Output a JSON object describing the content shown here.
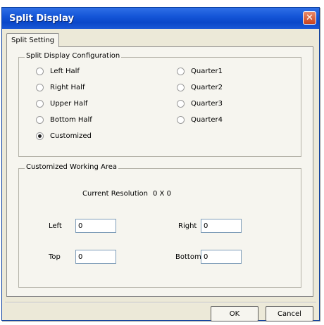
{
  "window": {
    "title": "Split Display",
    "close_symbol": "✕"
  },
  "tabs": [
    {
      "label": "Split Setting",
      "active": true
    }
  ],
  "configuration": {
    "legend": "Split Display Configuration",
    "options": [
      {
        "label": "Left Half",
        "checked": false
      },
      {
        "label": "Right Half",
        "checked": false
      },
      {
        "label": "Upper Half",
        "checked": false
      },
      {
        "label": "Bottom Half",
        "checked": false
      },
      {
        "label": "Customized",
        "checked": true
      },
      {
        "label": "Quarter1",
        "checked": false
      },
      {
        "label": "Quarter2",
        "checked": false
      },
      {
        "label": "Quarter3",
        "checked": false
      },
      {
        "label": "Quarter4",
        "checked": false
      }
    ]
  },
  "working_area": {
    "legend": "Customized Working Area",
    "resolution_label": "Current Resolution",
    "resolution_value": "0 X 0",
    "left_label": "Left",
    "left_value": "0",
    "right_label": "Right",
    "right_value": "0",
    "top_label": "Top",
    "top_value": "0",
    "bottom_label": "Bottom",
    "bottom_value": "0"
  },
  "buttons": {
    "ok": "OK",
    "cancel": "Cancel"
  }
}
